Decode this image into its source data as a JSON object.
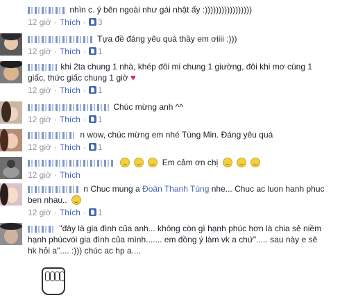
{
  "like_label": "Thích",
  "comments": [
    {
      "text": "nhìn c. ý bên ngoài như gái nhật ấy :)))))))))))))))))",
      "time": "12 giờ",
      "likes": "3"
    },
    {
      "text": "Tựa đề đáng yêu quá thầy em ơiiii :)))",
      "time": "12 giờ",
      "likes": "1"
    },
    {
      "text1": "khi 2ta chung 1 nhà, khép đôi mi chung 1 giường, đôi khi mơ cùng 1",
      "text2": "giấc, thức giấc chung 1 giờ",
      "time": "12 giờ",
      "likes": "1"
    },
    {
      "text": "Chúc mừng anh ^^",
      "time": "12 giờ",
      "likes": "1"
    },
    {
      "text": "n wow, chúc mừng em nhé Tùng Min. Đáng yêu quá",
      "time": "12 giờ",
      "likes": "1"
    },
    {
      "text": "Em cảm ơn chị",
      "time": "12 giờ",
      "likes": ""
    },
    {
      "text_a": "n Chuc mung a",
      "tag": "Đoàn Thanh Tùng",
      "text_b": "nhe... Chuc ac luon hanh phuc",
      "text2": "ben nhau..",
      "time": "12 giờ",
      "likes": "1"
    },
    {
      "text1": "\"đây là gia đình của anh... không còn gì hạnh phúc hơn là chia sẻ niềm",
      "text2": "hạnh phúcvói gia đình của mình....... em đồng ý làm vk a chứ\"..... sau này e sẽ",
      "text3": "hk hỏi a\".... :))) chúc ac hp a...."
    }
  ],
  "colors": {
    "link": "#4267b2",
    "meta": "#90949c",
    "text": "#1d2129",
    "heart": "#e0245e"
  },
  "icons": [
    "like-icon",
    "emoji-smile-icon",
    "heart-icon",
    "fist-sticker"
  ]
}
